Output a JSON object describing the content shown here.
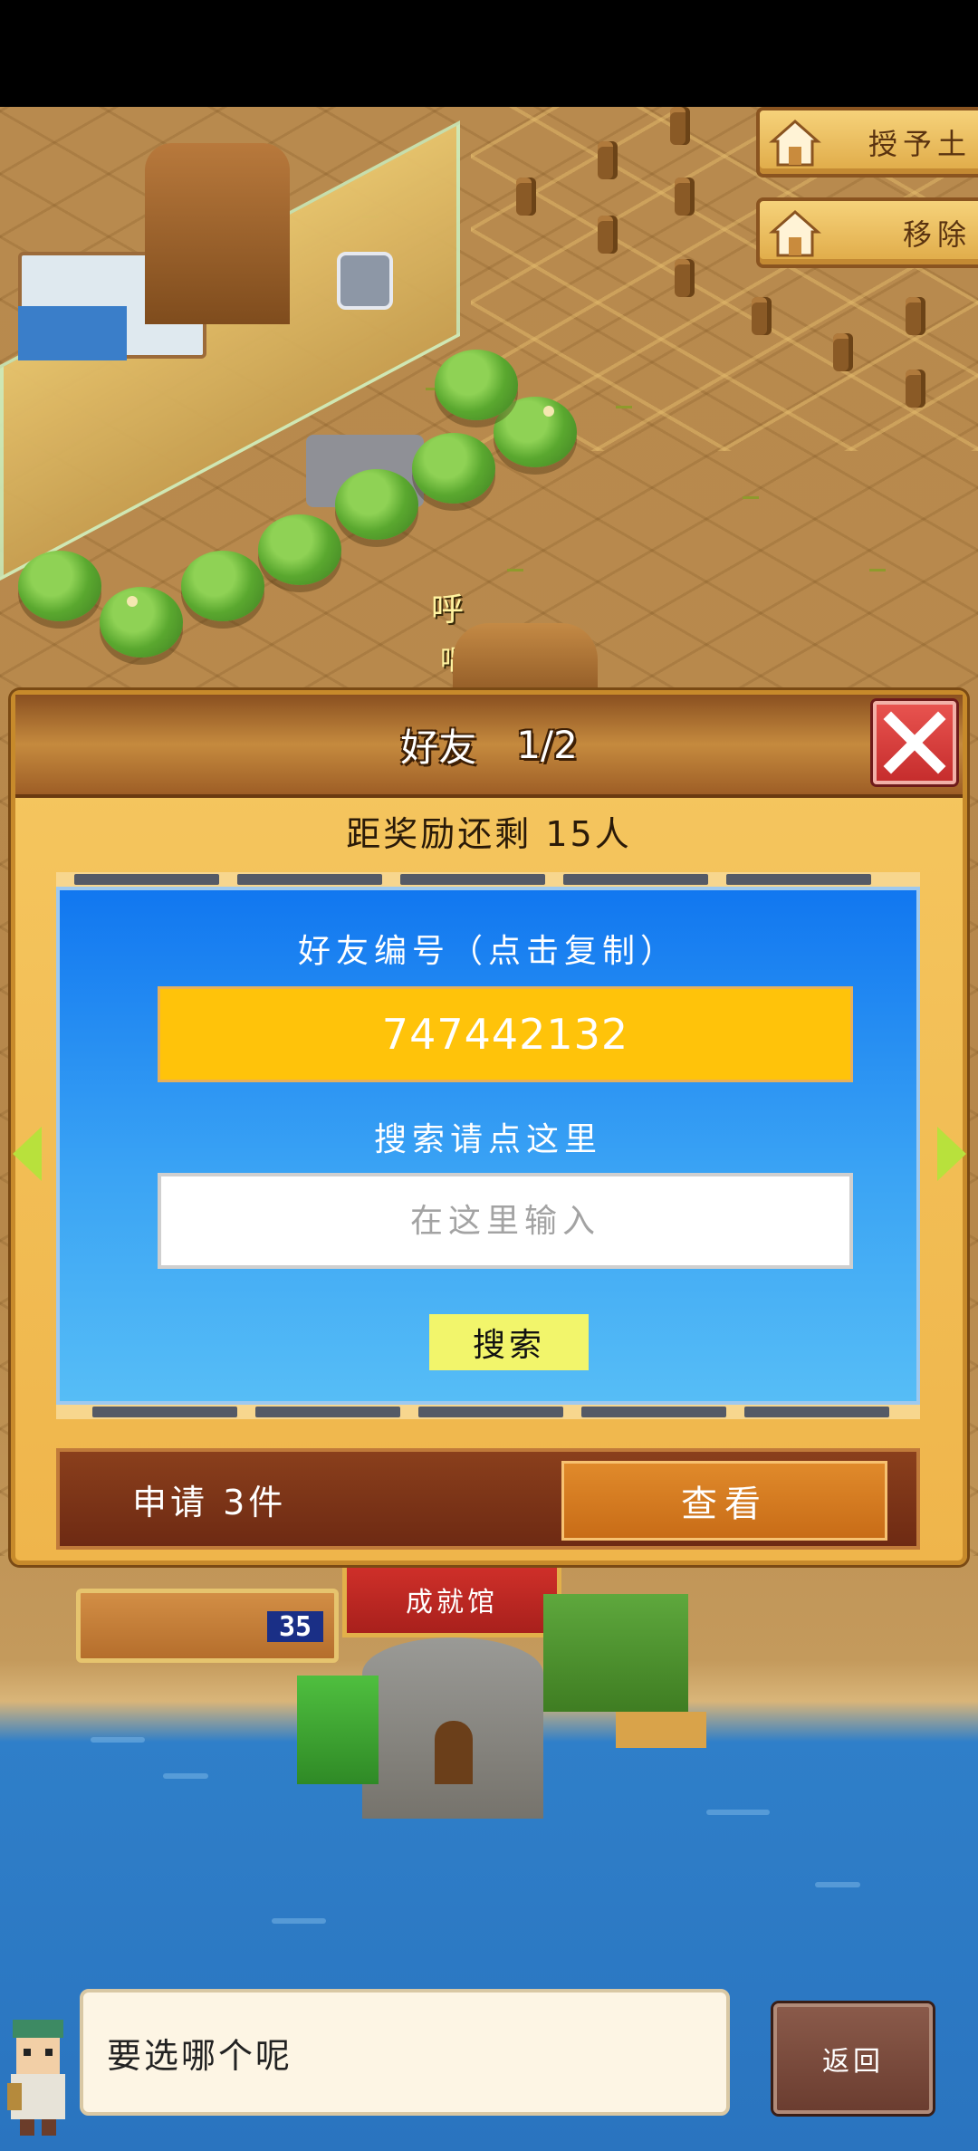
{
  "world": {
    "speech_fragments": [
      "呼",
      "唱"
    ],
    "top_right_menu": [
      {
        "label": "授予土",
        "icon": "house-icon"
      },
      {
        "label": "移除",
        "icon": "house-icon"
      }
    ],
    "achievement_hall_label": "成就馆",
    "counter_value": "35"
  },
  "dialog": {
    "title": "好友",
    "page": "1/2",
    "reward_text": "距奖励还剩 15人",
    "friend_code_label": "好友编号（点击复制）",
    "friend_code": "747442132",
    "search_label": "搜索请点这里",
    "search_placeholder": "在这里输入",
    "search_button": "搜索",
    "requests_text": "申请 3件",
    "view_button": "查看"
  },
  "bottom": {
    "message": "要选哪个呢",
    "back_button": "返回"
  },
  "colors": {
    "panel_blue": "#1177f0",
    "code_yellow": "#ffc30a",
    "close_red": "#c62d2d",
    "arrow_green": "#b8e13c"
  }
}
